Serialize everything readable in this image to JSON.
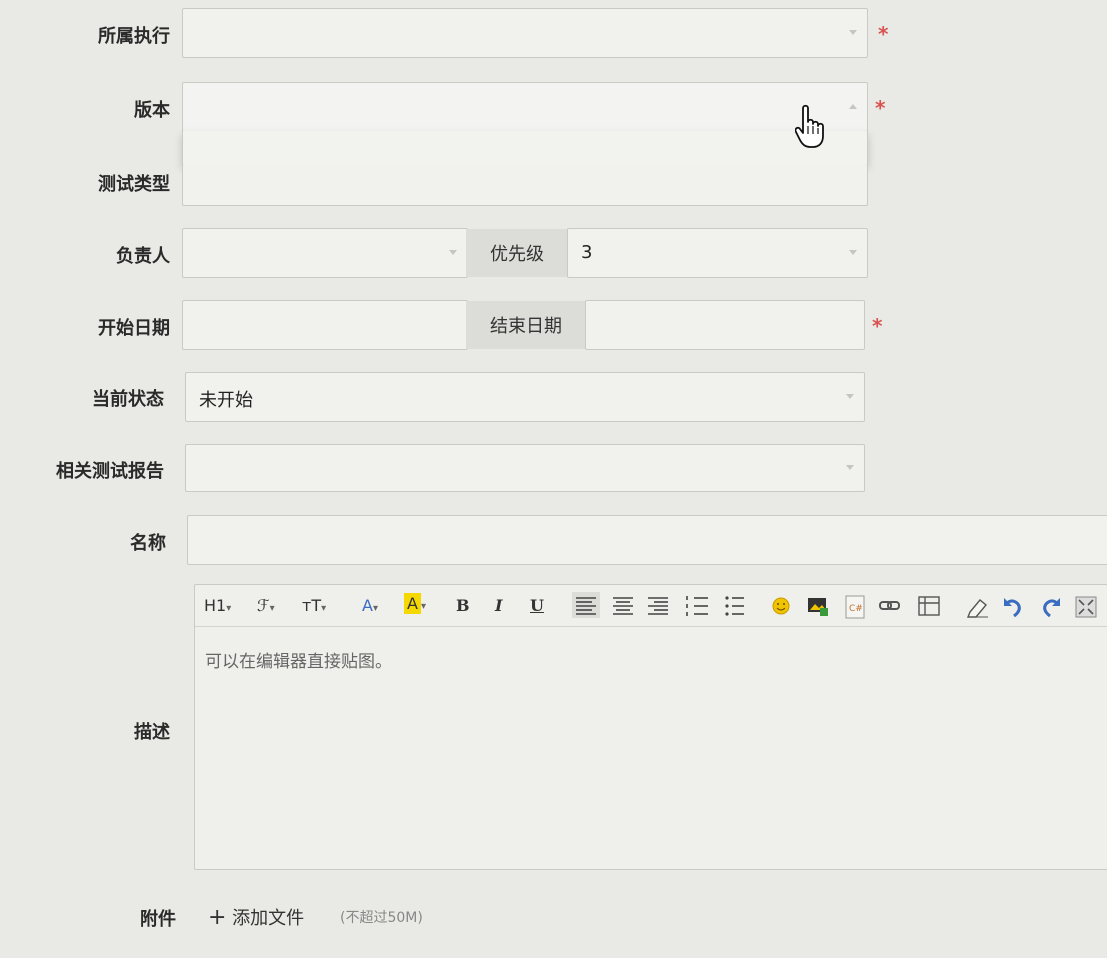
{
  "form": {
    "execution_label": "所属执行",
    "version_label": "版本",
    "test_type_label": "测试类型",
    "owner_label": "负责人",
    "priority_label": "优先级",
    "priority_value": "3",
    "start_date_label": "开始日期",
    "end_date_label": "结束日期",
    "status_label": "当前状态",
    "status_value": "未开始",
    "report_label": "相关测试报告",
    "name_label": "名称",
    "desc_label": "描述",
    "desc_placeholder": "可以在编辑器直接贴图。",
    "attachment_label": "附件",
    "add_file": "添加文件",
    "size_hint": "(不超过50M)",
    "required_mark": "*"
  },
  "toolbar": {
    "heading": "H1",
    "font_family": "ℱ",
    "font_size": "тT",
    "font_color": "A",
    "bg_color": "A",
    "bold": "B",
    "italic": "I",
    "underline": "U"
  },
  "colors": {
    "required": "#d9534f",
    "addon_bg": "#dcdcd8",
    "highlight": "#f5d800"
  },
  "icons": [
    "caret-down-icon",
    "pointer-cursor-icon",
    "plus-icon",
    "emoticon-icon",
    "image-icon",
    "code-icon",
    "link-icon",
    "table-icon",
    "eraser-icon",
    "undo-icon",
    "redo-icon",
    "fullscreen-icon"
  ]
}
